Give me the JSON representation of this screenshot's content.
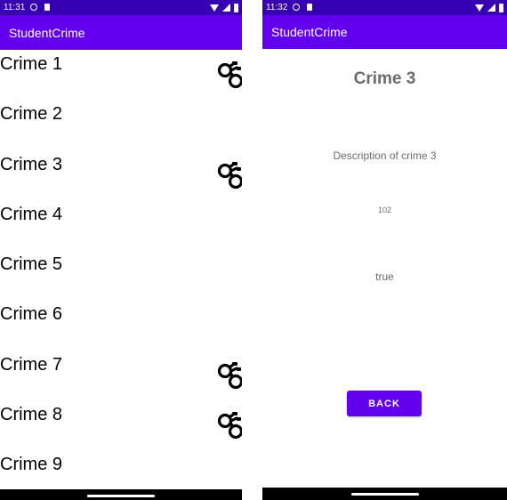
{
  "left": {
    "status_time": "11:31",
    "app_title": "StudentCrime",
    "crimes": [
      {
        "title": "Crime 1",
        "solved": true
      },
      {
        "title": "Crime 2",
        "solved": false
      },
      {
        "title": "Crime 3",
        "solved": true
      },
      {
        "title": "Crime 4",
        "solved": false
      },
      {
        "title": "Crime 5",
        "solved": false
      },
      {
        "title": "Crime 6",
        "solved": false
      },
      {
        "title": "Crime 7",
        "solved": true
      },
      {
        "title": "Crime 8",
        "solved": true
      },
      {
        "title": "Crime 9",
        "solved": false
      }
    ]
  },
  "right": {
    "status_time": "11:32",
    "app_title": "StudentCrime",
    "crime_title": "Crime 3",
    "description": "Description of crime 3",
    "number": "102",
    "solved": "true",
    "back_label": "BACK"
  },
  "colors": {
    "status_bar": "#3700B3",
    "app_bar": "#6200EE",
    "button": "#6200EE",
    "detail_text": "#6b6b6b"
  },
  "icons": {
    "solved_icon": "handcuffs-icon"
  }
}
